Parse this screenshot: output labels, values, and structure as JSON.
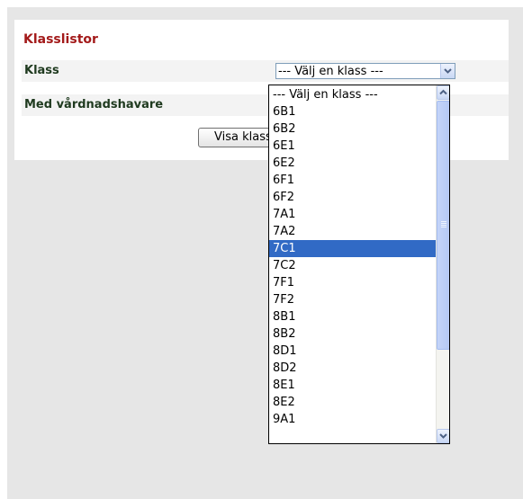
{
  "form": {
    "title": "Klasslistor",
    "class_label": "Klass",
    "guardian_label": "Med vårdnadshavare",
    "class_select": {
      "selected": "--- Välj en klass ---",
      "highlighted": "7C1"
    },
    "submit_label": "Visa klasslista"
  },
  "dropdown": {
    "options": [
      "--- Välj en klass ---",
      "6B1",
      "6B2",
      "6E1",
      "6E2",
      "6F1",
      "6F2",
      "7A1",
      "7A2",
      "7C1",
      "7C2",
      "7F1",
      "7F2",
      "8B1",
      "8B2",
      "8D1",
      "8D2",
      "8E1",
      "8E2",
      "9A1"
    ]
  },
  "icons": {
    "select_arrow": "chevron-down-icon",
    "scroll_up": "chevron-up-icon",
    "scroll_down": "chevron-down-icon",
    "scroll_grip": "grip-lines-icon"
  },
  "colors": {
    "title": "#a31a1a",
    "label": "#1f3a1f",
    "highlight": "#316ac5",
    "page_background": "#e6e6e6"
  }
}
